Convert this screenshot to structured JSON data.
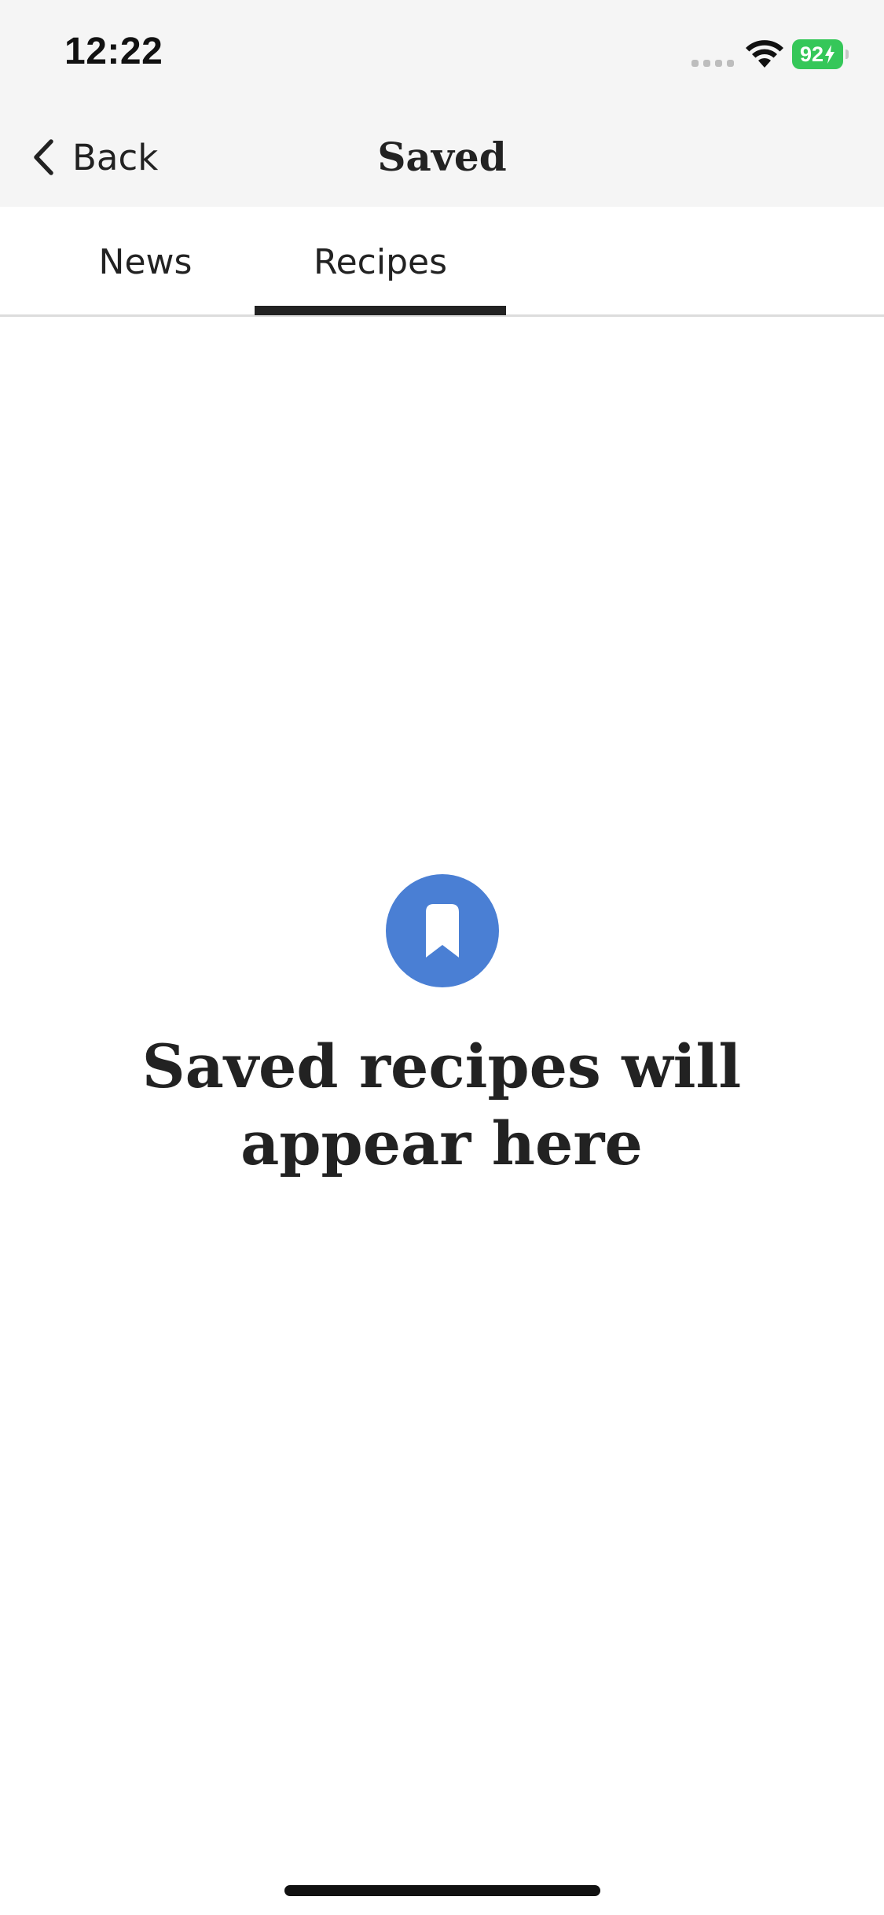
{
  "status_bar": {
    "time": "12:22",
    "battery_level": "92",
    "battery_color": "#35c759"
  },
  "nav": {
    "back_label": "Back",
    "title": "Saved"
  },
  "tabs": [
    {
      "label": "News",
      "selected": false
    },
    {
      "label": "Recipes",
      "selected": true
    }
  ],
  "empty_state": {
    "icon": "bookmark-icon",
    "icon_color": "#4a7fd4",
    "line1": "Saved recipes will",
    "line2": "appear here"
  }
}
